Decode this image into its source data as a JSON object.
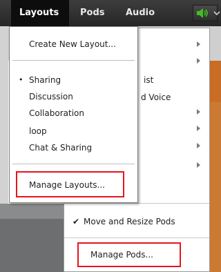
{
  "menubar": {
    "items": [
      {
        "label": "Layouts",
        "active": true
      },
      {
        "label": "Pods",
        "active": false
      },
      {
        "label": "Audio",
        "active": false
      }
    ],
    "speaker_icon": "speaker-icon",
    "dropdown_icon": "chevron-down-icon"
  },
  "layouts_menu": {
    "create_new": "Create New Layout...",
    "items": [
      {
        "label": "Sharing",
        "selected": true
      },
      {
        "label": "Discussion",
        "selected": false
      },
      {
        "label": "Collaboration",
        "selected": false
      },
      {
        "label": "loop",
        "selected": false
      },
      {
        "label": "Chat & Sharing",
        "selected": false
      }
    ],
    "selected_marker": "•",
    "manage_layouts": "Manage Layouts..."
  },
  "pods_menu": {
    "partial_items": [
      "ist",
      "d Voice"
    ],
    "move_resize_check": "✔",
    "move_resize": "Move and Resize Pods",
    "manage_pods": "Manage Pods..."
  },
  "colors": {
    "menubar_bg": "#2f2f2f",
    "highlight": "#e8121c",
    "speaker_green": "#42c022",
    "accent_orange": "#cc7a33"
  }
}
